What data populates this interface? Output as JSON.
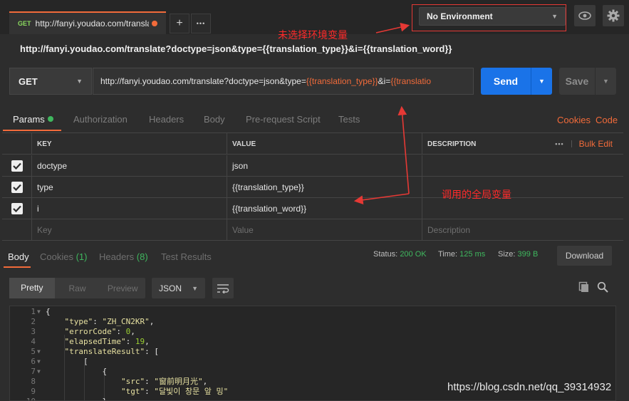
{
  "tab": {
    "method": "GET",
    "title": "http://fanyi.youdao.com/translat"
  },
  "tab_actions": {
    "add": "+",
    "more": "•••"
  },
  "environment": {
    "selected": "No Environment"
  },
  "request": {
    "title": "http://fanyi.youdao.com/translate?doctype=json&type={{translation_type}}&i={{translation_word}}",
    "method": "GET",
    "url_prefix": "http://fanyi.youdao.com/translate?doctype=json&type=",
    "url_var1": "{{translation_type}}",
    "url_mid": "&i=",
    "url_var2": "{{translatio",
    "send_label": "Send",
    "save_label": "Save"
  },
  "request_tabs": {
    "params": "Params",
    "authorization": "Authorization",
    "headers": "Headers",
    "body": "Body",
    "prerequest": "Pre-request Script",
    "tests": "Tests",
    "cookies": "Cookies",
    "code": "Code"
  },
  "params_table": {
    "headers": {
      "key": "KEY",
      "value": "VALUE",
      "description": "DESCRIPTION",
      "bulk_edit": "Bulk Edit",
      "more": "•••"
    },
    "rows": [
      {
        "key": "doctype",
        "value": "json",
        "checked": true
      },
      {
        "key": "type",
        "value": "{{translation_type}}",
        "checked": true
      },
      {
        "key": "i",
        "value": "{{translation_word}}",
        "checked": true
      }
    ],
    "placeholder": {
      "key": "Key",
      "value": "Value",
      "description": "Description"
    }
  },
  "response_tabs": {
    "body": "Body",
    "cookies": "Cookies",
    "cookies_count": "(1)",
    "headers": "Headers",
    "headers_count": "(8)",
    "test_results": "Test Results"
  },
  "response_status": {
    "status_label": "Status:",
    "status_value": "200 OK",
    "time_label": "Time:",
    "time_value": "125 ms",
    "size_label": "Size:",
    "size_value": "399 B",
    "download": "Download"
  },
  "body_view": {
    "pretty": "Pretty",
    "raw": "Raw",
    "preview": "Preview",
    "format": "JSON"
  },
  "code_lines": [
    {
      "n": "1",
      "fold": true
    },
    {
      "n": "2",
      "fold": false
    },
    {
      "n": "3",
      "fold": false
    },
    {
      "n": "4",
      "fold": false
    },
    {
      "n": "5",
      "fold": true
    },
    {
      "n": "6",
      "fold": true
    },
    {
      "n": "7",
      "fold": true
    },
    {
      "n": "8",
      "fold": false
    },
    {
      "n": "9",
      "fold": false
    },
    {
      "n": "10",
      "fold": false
    }
  ],
  "code_text": {
    "l1": "{",
    "l2k": "\"type\"",
    "l2v": "\"ZH_CN2KR\"",
    "l3k": "\"errorCode\"",
    "l3v": "0",
    "l4k": "\"elapsedTime\"",
    "l4v": "19",
    "l5k": "\"translateResult\"",
    "l5v": "[",
    "l6": "[",
    "l7": "{",
    "l8k": "\"src\"",
    "l8v": "\"窗前明月光\"",
    "l9k": "\"tgt\"",
    "l9v": "\"달빛이 창문 앞 밍\"",
    "l10": "}"
  },
  "annotations": {
    "no_env": "未选择环境变量",
    "global_var": "调用的全局变量"
  },
  "watermark": "https://blog.csdn.net/qq_39314932",
  "colors": {
    "accent": "#f26b3a",
    "send": "#1a73e8",
    "success": "#3fb75e",
    "annotation": "#ff2a2a"
  }
}
